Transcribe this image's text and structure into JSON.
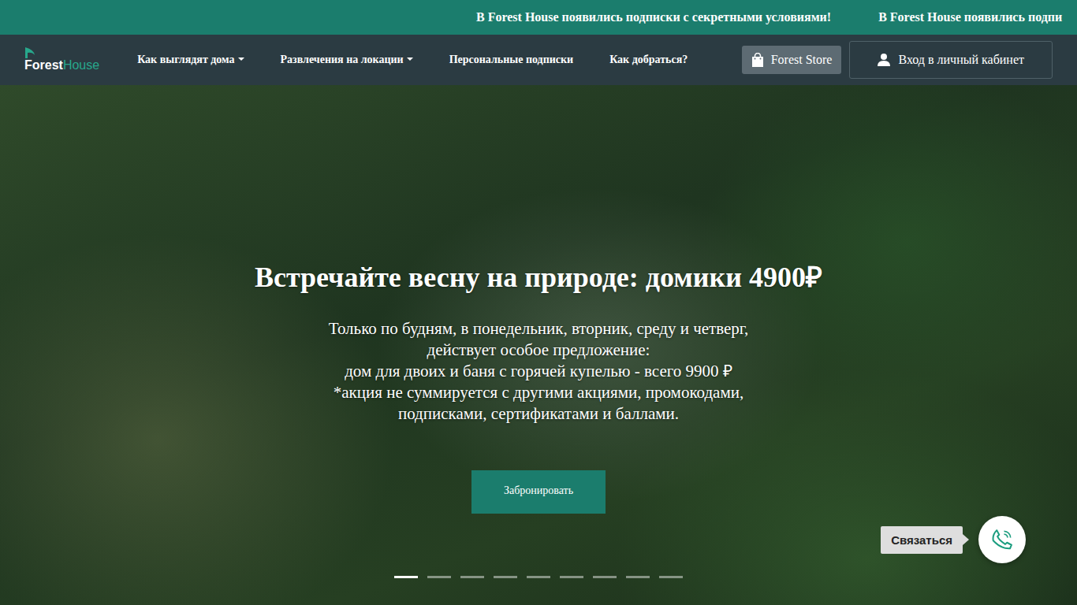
{
  "announcement": {
    "items": [
      "В Forest House появились подписки с секретными условиями!",
      "В Forest House появились подпи"
    ]
  },
  "logo": {
    "first": "Forest",
    "second": "House"
  },
  "nav": {
    "items": [
      {
        "label": "Как выглядят дома",
        "dropdown": true
      },
      {
        "label": "Развлечения на локации",
        "dropdown": true
      },
      {
        "label": "Персональные подписки",
        "dropdown": false
      },
      {
        "label": "Как добраться?",
        "dropdown": false
      }
    ],
    "store_button": "Forest Store",
    "login_button": "Вход в личный кабинет"
  },
  "hero": {
    "title": "Встречайте весну на природе: домики 4900₽",
    "lines": [
      "Только по будням, в понедельник, вторник, среду и четверг,",
      "действует особое предложение:",
      "дом для двоих и баня с горячей купелью - всего 9900 ₽",
      "*акция не суммируется с другими акциями, промокодами,",
      "подписками, сертификатами и баллами."
    ],
    "button": "Забронировать",
    "slides": [
      {
        "selected": true
      },
      {
        "selected": false
      },
      {
        "selected": false
      },
      {
        "selected": false
      },
      {
        "selected": false
      },
      {
        "selected": false
      },
      {
        "selected": false
      },
      {
        "selected": false
      },
      {
        "selected": false
      }
    ]
  },
  "contact": {
    "label": "Связаться"
  }
}
